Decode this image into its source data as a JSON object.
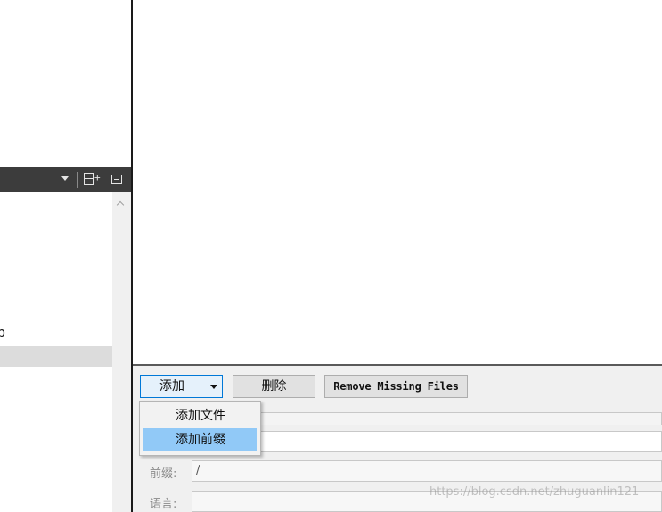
{
  "left_panel": {
    "list_item_text": "p",
    "toolbar_icons": [
      "dropdown-arrow-icon",
      "split-add-icon",
      "minimize-icon"
    ]
  },
  "files_panel": {
    "add_button_label": "添加",
    "delete_button_label": "删除",
    "remove_missing_label": "Remove Missing Files",
    "add_menu": {
      "items": [
        "添加文件",
        "添加前缀"
      ],
      "highlighted_index": 1
    },
    "prefix_label": "前缀:",
    "prefix_value": "/",
    "language_label": "语言:",
    "language_value": ""
  },
  "watermark": "https://blog.csdn.net/zhuguanlin121",
  "colors": {
    "dock_titlebar": "#3c3c3c",
    "panel_bg": "#f0f0f0",
    "menu_highlight": "#91c9f7",
    "active_button_border": "#0078d7"
  }
}
